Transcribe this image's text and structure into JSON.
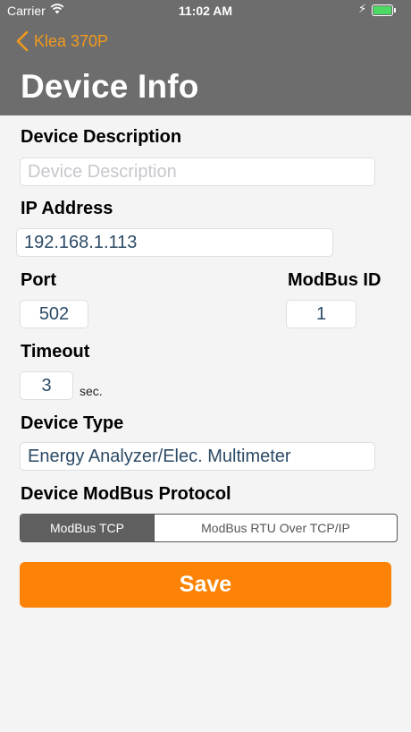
{
  "status_bar": {
    "carrier": "Carrier",
    "time": "11:02 AM"
  },
  "nav": {
    "back_label": "Klea 370P",
    "title": "Device Info"
  },
  "form": {
    "description": {
      "label": "Device Description",
      "value": "",
      "placeholder": "Device Description"
    },
    "ip": {
      "label": "IP Address",
      "value": "192.168.1.113"
    },
    "port": {
      "label": "Port",
      "value": "502"
    },
    "modbus_id": {
      "label": "ModBus ID",
      "value": "1"
    },
    "timeout": {
      "label": "Timeout",
      "value": "3",
      "unit": "sec."
    },
    "device_type": {
      "label": "Device Type",
      "value": "Energy Analyzer/Elec. Multimeter"
    },
    "protocol": {
      "label": "Device ModBus Protocol",
      "options": [
        "ModBus TCP",
        "ModBus RTU Over TCP/IP"
      ],
      "selected": "ModBus TCP"
    }
  },
  "save_label": "Save",
  "colors": {
    "accent": "#fc8305",
    "header": "#6d6d6d",
    "battery": "#4cd964"
  }
}
